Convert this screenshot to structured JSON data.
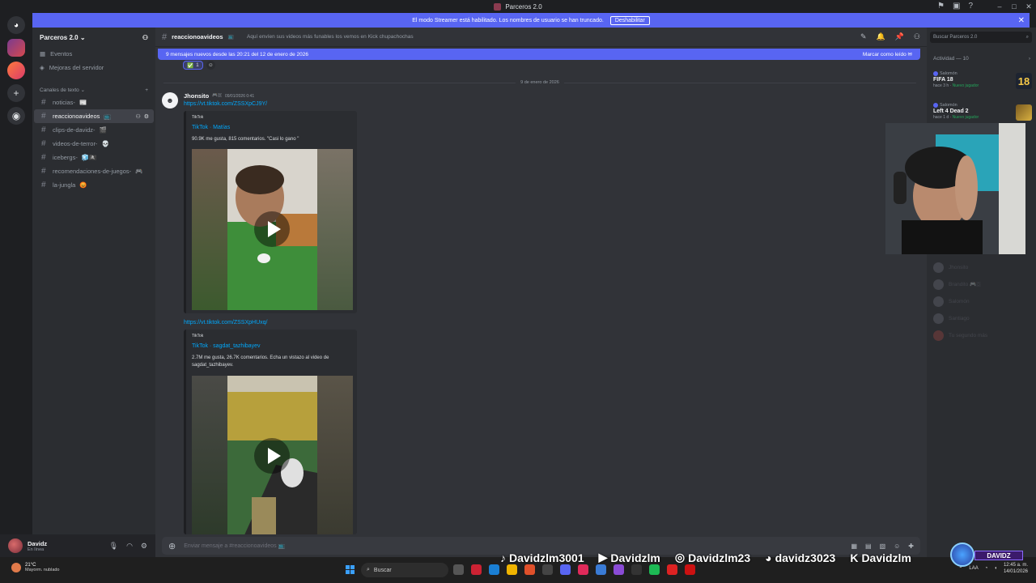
{
  "window": {
    "title": "Parceros 2.0"
  },
  "streamer_banner": {
    "text": "El modo Streamer está habilitado. Los nombres de usuario se han truncado.",
    "button": "Deshabilitar"
  },
  "server": {
    "name": "Parceros 2.0"
  },
  "sidebar": {
    "nav": [
      {
        "label": "Eventos"
      },
      {
        "label": "Mejoras del servidor"
      }
    ],
    "category": "Canales de texto",
    "channels": [
      {
        "label": "noticias-",
        "emoji": "📰"
      },
      {
        "label": "reaccionoavideos",
        "emoji": "📺"
      },
      {
        "label": "clips-de-davidz-",
        "emoji": "🎬"
      },
      {
        "label": "videos-de-terror-",
        "emoji": "💀"
      },
      {
        "label": "icebergs-",
        "emoji": "🧊🏴‍☠️"
      },
      {
        "label": "recomendaciones-de-juegos-",
        "emoji": "🎮"
      },
      {
        "label": "la-jungla",
        "emoji": "😡"
      }
    ]
  },
  "user": {
    "name": "Davidz",
    "status": "En línea"
  },
  "chat_header": {
    "channel": "reaccionoavideos",
    "topic": "Aquí envíen sus videos más funables los vemos en Kick chupachochas"
  },
  "new_messages_bar": {
    "text": "9 mensajes nuevos desde las 20:21 del 12 de enero de 2026",
    "action": "Marcar como leído"
  },
  "reaction": {
    "emoji": "✅",
    "count": "1"
  },
  "date_divider": "9 de enero de 2026",
  "message": {
    "author": "Jhonsito",
    "badge": "🎮🇩",
    "timestamp": "09/01/2026 0:41",
    "link1": "https://vt.tiktok.com/ZSSXpCJ9Y/",
    "embed1": {
      "provider": "TikTok",
      "title": "TikTok · Matías",
      "description": "90.9K me gusta, 815 comentarios. \"Casi lo gano \""
    },
    "link2": "https://vt.tiktok.com/ZSSXpHUxq/",
    "embed2": {
      "provider": "TikTok",
      "title": "TikTok · sagdat_tazhibayev",
      "description": "2.7M me gusta, 26.7K comentarios. Echa un vistazo al video de sagdat_tazhibayev."
    }
  },
  "composer": {
    "placeholder": "Enviar mensaje a #reaccionoavideos 📺"
  },
  "right_panel": {
    "search_placeholder": "Buscar Parceros 2.0",
    "activity_header": "Actividad — 10",
    "activities": [
      {
        "user": "Salomón",
        "game": "FIFA 18",
        "meta": "hace 3 h",
        "tag": "Nuevo jugador",
        "icon_text": "18"
      },
      {
        "user": "Salomón",
        "game": "Left 4 Dead 2",
        "meta": "hace 1 d",
        "tag": "Nuevo jugador",
        "icon_text": ""
      }
    ],
    "members": [
      {
        "name": "Jhonsito"
      },
      {
        "name": "Brandito 🎮🇩"
      },
      {
        "name": "Salomón"
      },
      {
        "name": "Santiago"
      },
      {
        "name": "Tu segundo más"
      }
    ]
  },
  "taskbar": {
    "weather_temp": "21°C",
    "weather_desc": "Mayorm. nublado",
    "search": "Buscar",
    "lang": "LAA",
    "time": "12:45 a. m.",
    "date": "14/01/2026"
  },
  "overlay": {
    "socials": [
      {
        "icon": "tiktok-icon",
        "glyph": "♪",
        "handle": "Davidzlm3001"
      },
      {
        "icon": "youtube-icon",
        "glyph": "▶",
        "handle": "Davidzlm"
      },
      {
        "icon": "instagram-icon",
        "glyph": "◎",
        "handle": "Davidzlm23"
      },
      {
        "icon": "discord-icon",
        "glyph": "◕",
        "handle": "davidz3023"
      },
      {
        "icon": "kick-icon",
        "glyph": "K",
        "handle": "Davidzlm"
      }
    ],
    "brand": "DAVIDZ"
  }
}
